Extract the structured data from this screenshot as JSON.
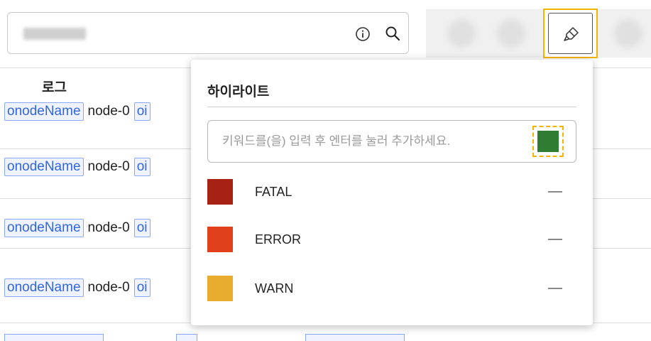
{
  "toolbar": {
    "search_icons": [
      "info-icon",
      "search-icon"
    ],
    "highlight_icon": "highlighter-icon",
    "accent_color": "#f4b400"
  },
  "log_table": {
    "column_header": "로그",
    "rows": [
      {
        "tag1": "onodeName",
        "value1": "node-0",
        "tag2": "oi"
      },
      {
        "tag1": "onodeName",
        "value1": "node-0",
        "tag2": "oi"
      },
      {
        "tag1": "onodeName",
        "value1": "node-0",
        "tag2": "oi"
      },
      {
        "tag1": "onodeName",
        "value1": "node-0",
        "tag2": "oi"
      }
    ]
  },
  "highlight_popover": {
    "title": "하이라이트",
    "input_placeholder": "키워드를(을) 입력 후 엔터를 눌러 추가하세요.",
    "picker_color": "#2e7d32",
    "levels": [
      {
        "label": "FATAL",
        "color": "#a52215"
      },
      {
        "label": "ERROR",
        "color": "#e0401c"
      },
      {
        "label": "WARN",
        "color": "#e8ad2e"
      }
    ]
  }
}
